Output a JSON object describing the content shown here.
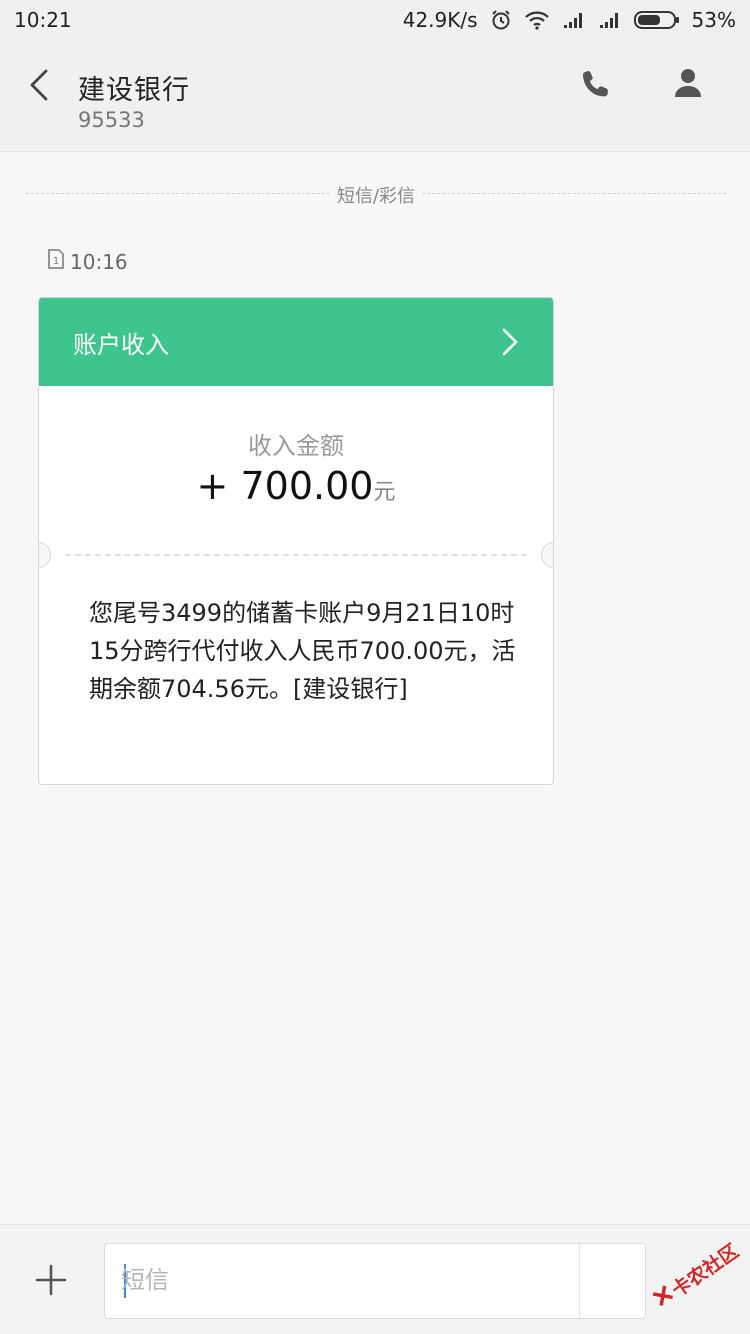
{
  "status_bar": {
    "time": "10:21",
    "net_speed": "42.9K/s",
    "battery": "53%"
  },
  "header": {
    "title": "建设银行",
    "number": "95533"
  },
  "thread": {
    "divider_label": "短信/彩信",
    "message_time": "10:16",
    "sim_slot": "1"
  },
  "card": {
    "heading": "账户收入",
    "amount_label": "收入金额",
    "amount": "+ 700.00",
    "unit": "元",
    "body": "您尾号3499的储蓄卡账户9月21日10时15分跨行代付收入人民币700.00元，活期余额704.56元。[建设银行]",
    "accent_color": "#3ec58e"
  },
  "composer": {
    "placeholder": "短信"
  },
  "watermark": {
    "text": "卡农社区"
  },
  "icons": [
    "back-icon",
    "phone-icon",
    "contact-icon",
    "chevron-right-icon",
    "plus-icon",
    "sim-icon",
    "alarm-icon",
    "wifi-icon",
    "signal-icon",
    "battery-icon"
  ]
}
